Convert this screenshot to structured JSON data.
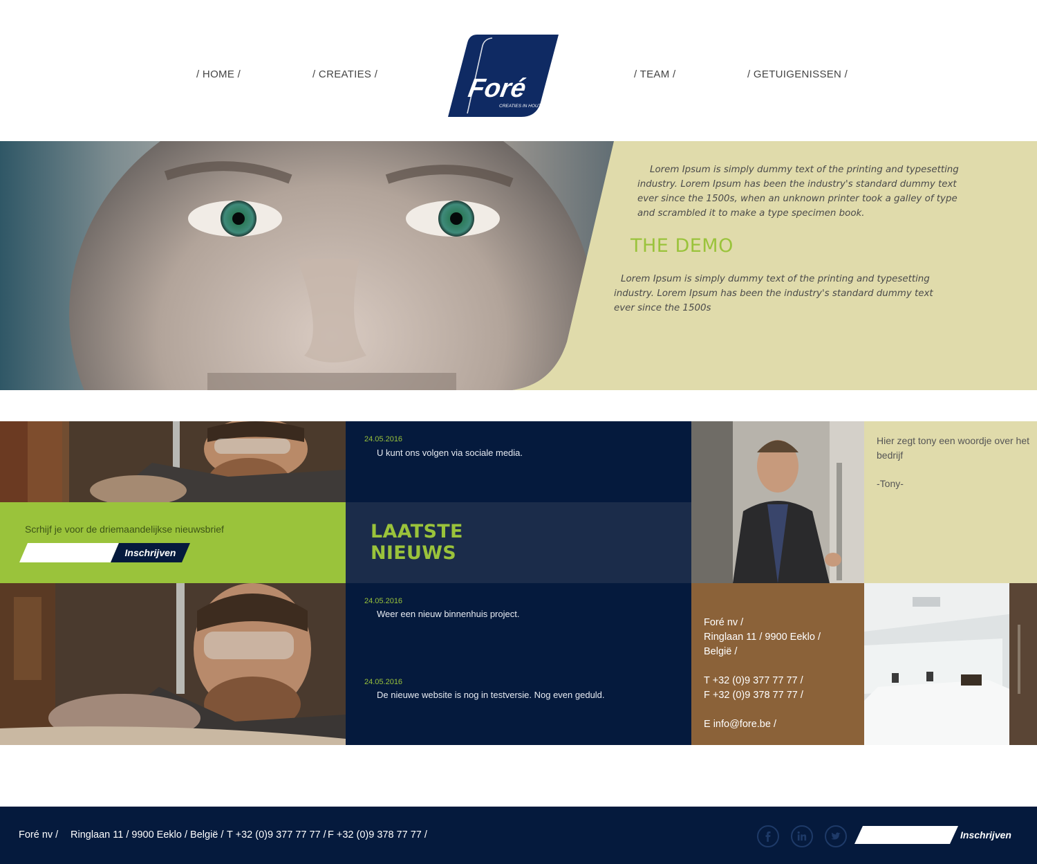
{
  "nav": {
    "home": "/ HOME /",
    "creaties": "/ CREATIES /",
    "team": "/ TEAM /",
    "getuigenissen": "/ GETUIGENISSEN /"
  },
  "logo": {
    "brand": "Foré",
    "tagline": "CREATIES IN HOUT",
    "color": "#0f2a63"
  },
  "hero": {
    "paragraph1": "Lorem Ipsum is simply dummy text of the printing and typesetting industry. Lorem Ipsum has been the industry's standard dummy text ever since the 1500s, when an unknown printer took a galley of type and scrambled it to make a type specimen book.",
    "heading": "THE DEMO",
    "paragraph2": "Lorem Ipsum is simply dummy text of the printing and typesetting industry. Lorem Ipsum has been the industry's standard dummy text ever since the 1500s"
  },
  "news": [
    {
      "date": "24.05.2016",
      "text": "U kunt ons volgen via sociale media."
    },
    {
      "date": "24.05.2016",
      "text": "Weer een nieuw binnenhuis project."
    },
    {
      "date": "24.05.2016",
      "text": "De nieuwe website is nog in testversie. Nog even geduld."
    }
  ],
  "newsletter": {
    "label": "Scrhijf je voor de driemaandelijkse nieuwsbrief",
    "button": "Inschrijven"
  },
  "latest_news_title": "LAATSTE NIEUWS",
  "testimonial": {
    "text": "Hier zegt tony een woordje over het bedrijf",
    "author": "-Tony-"
  },
  "contact": {
    "company": "Foré nv /",
    "address": "Ringlaan 11 / 9900 Eeklo /",
    "country": "België /",
    "phone": "T +32 (0)9 377 77 77 /",
    "fax": "F +32 (0)9 378 77 77 /",
    "email": "E info@fore.be /"
  },
  "footer": {
    "company": "Foré nv /",
    "address": "Ringlaan 11 / 9900 Eeklo / België /",
    "phone": "T +32 (0)9 377 77 77 /",
    "fax": "F +32 (0)9 378 77 77 /",
    "button": "Inschrijven",
    "socials": [
      "facebook-icon",
      "linkedin-icon",
      "twitter-icon"
    ]
  },
  "colors": {
    "navy": "#051a3d",
    "green": "#9ac33b",
    "beige": "#e0dbab",
    "brown": "#8b6239"
  }
}
